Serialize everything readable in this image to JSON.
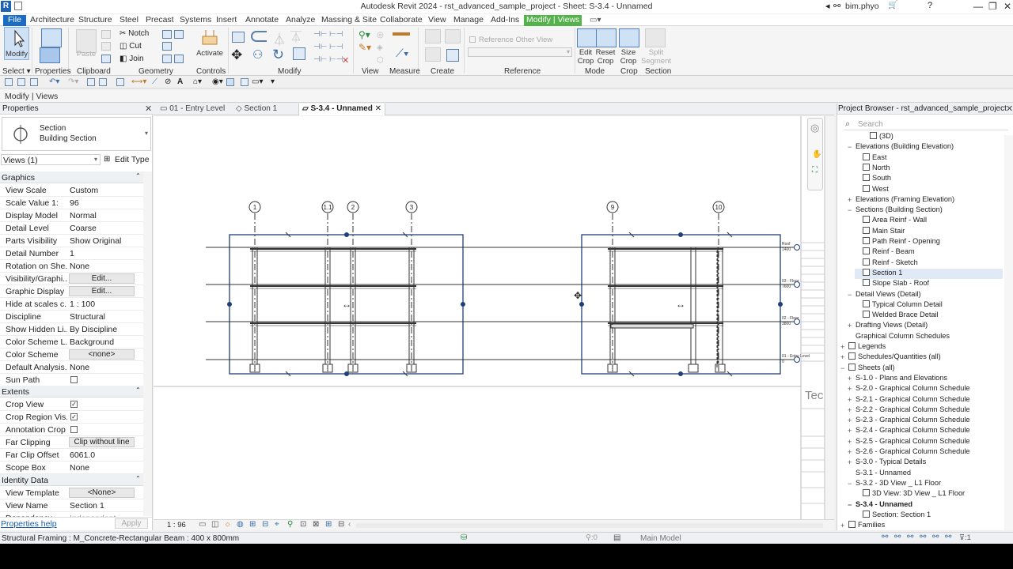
{
  "titlebar": {
    "title": "Autodesk Revit 2024 - rst_advanced_sample_project - Sheet: S-3.4 - Unnamed",
    "user": "bim.phyo",
    "app_logo": "R"
  },
  "menu": {
    "tabs": [
      "File",
      "Architecture",
      "Structure",
      "Steel",
      "Precast",
      "Systems",
      "Insert",
      "Annotate",
      "Analyze",
      "Massing & Site",
      "Collaborate",
      "View",
      "Manage",
      "Add-Ins",
      "Modify | Views"
    ]
  },
  "ribbon": {
    "modify_label": "Modify",
    "notch_label": "Notch",
    "cut_label": "Cut",
    "join_label": "Join",
    "paste_label": "Paste",
    "activate_label": "Activate",
    "reference_other_view": "Reference Other View",
    "edit_crop": "Edit Crop",
    "reset_crop": "Reset Crop",
    "size_crop": "Size Crop",
    "split_segment": "Split Segment",
    "panels": [
      "Select",
      "Properties",
      "Clipboard",
      "Geometry",
      "Controls",
      "Modify",
      "View",
      "Measure",
      "Create",
      "Reference",
      "Mode",
      "Crop",
      "Section"
    ]
  },
  "options_bar": {
    "text": "Modify | Views"
  },
  "properties": {
    "header": "Properties",
    "type_line1": "Section",
    "type_line2": "Building Section",
    "views_selector": "Views (1)",
    "edit_type": "Edit Type",
    "groups": {
      "graphics": "Graphics",
      "extents": "Extents",
      "identity": "Identity Data"
    },
    "graphics_rows": [
      {
        "k": "View Scale",
        "v": "Custom"
      },
      {
        "k": "Scale Value    1:",
        "v": "96"
      },
      {
        "k": "Display Model",
        "v": "Normal"
      },
      {
        "k": "Detail Level",
        "v": "Coarse"
      },
      {
        "k": "Parts Visibility",
        "v": "Show Original"
      },
      {
        "k": "Detail Number",
        "v": "1"
      },
      {
        "k": "Rotation on She...",
        "v": "None"
      },
      {
        "k": "Visibility/Graphi...",
        "v": "Edit..."
      },
      {
        "k": "Graphic Display ...",
        "v": "Edit..."
      },
      {
        "k": "Hide at scales c...",
        "v": "1 : 100"
      },
      {
        "k": "Discipline",
        "v": "Structural"
      },
      {
        "k": "Show Hidden Li...",
        "v": "By Discipline"
      },
      {
        "k": "Color Scheme L...",
        "v": "Background"
      },
      {
        "k": "Color Scheme",
        "v": "<none>"
      },
      {
        "k": "Default Analysis...",
        "v": "None"
      },
      {
        "k": "Sun Path",
        "v": ""
      }
    ],
    "extents_rows": [
      {
        "k": "Crop View",
        "v": "✓"
      },
      {
        "k": "Crop Region Vis...",
        "v": "✓"
      },
      {
        "k": "Annotation Crop",
        "v": ""
      },
      {
        "k": "Far Clipping",
        "v": "Clip without line"
      },
      {
        "k": "Far Clip Offset",
        "v": "6061.0"
      },
      {
        "k": "Scope Box",
        "v": "None"
      }
    ],
    "identity_rows": [
      {
        "k": "View Template",
        "v": "<None>"
      },
      {
        "k": "View Name",
        "v": "Section 1"
      },
      {
        "k": "Dependency",
        "v": "Independent"
      }
    ],
    "help_link": "Properties help",
    "apply": "Apply"
  },
  "view_tabs": [
    "01 - Entry Level",
    "Section 1",
    "S-3.4 - Unnamed"
  ],
  "canvas": {
    "grid_labels_left": [
      "1",
      "1.1",
      "2",
      "3"
    ],
    "grid_labels_right": [
      "9",
      "10"
    ],
    "levels": [
      "Roof",
      "03 - Floor",
      "02 - Floor",
      "01 - Entry Level"
    ],
    "level_values": [
      "1400",
      "7600",
      "3800",
      "0"
    ],
    "titleblock_text": "Tec",
    "view_scale": "1 : 96"
  },
  "browser": {
    "header": "Project Browser - rst_advanced_sample_project",
    "search_placeholder": "Search",
    "items": [
      {
        "label": "(3D)",
        "level": 3,
        "icon": true,
        "exp": ""
      },
      {
        "label": "Elevations (Building Elevation)",
        "level": 1,
        "icon": false,
        "exp": "−"
      },
      {
        "label": "East",
        "level": 2,
        "icon": true,
        "exp": ""
      },
      {
        "label": "North",
        "level": 2,
        "icon": true,
        "exp": ""
      },
      {
        "label": "South",
        "level": 2,
        "icon": true,
        "exp": ""
      },
      {
        "label": "West",
        "level": 2,
        "icon": true,
        "exp": ""
      },
      {
        "label": "Elevations (Framing Elevation)",
        "level": 1,
        "icon": false,
        "exp": "+"
      },
      {
        "label": "Sections (Building Section)",
        "level": 1,
        "icon": false,
        "exp": "−"
      },
      {
        "label": "Area Reinf - Wall",
        "level": 2,
        "icon": true,
        "exp": ""
      },
      {
        "label": "Main Stair",
        "level": 2,
        "icon": true,
        "exp": ""
      },
      {
        "label": "Path Reinf - Opening",
        "level": 2,
        "icon": true,
        "exp": ""
      },
      {
        "label": "Reinf - Beam",
        "level": 2,
        "icon": true,
        "exp": ""
      },
      {
        "label": "Reinf - Sketch",
        "level": 2,
        "icon": true,
        "exp": ""
      },
      {
        "label": "Section 1",
        "level": 2,
        "icon": true,
        "exp": "",
        "sel": true
      },
      {
        "label": "Slope Slab - Roof",
        "level": 2,
        "icon": true,
        "exp": ""
      },
      {
        "label": "Detail Views (Detail)",
        "level": 1,
        "icon": false,
        "exp": "−"
      },
      {
        "label": "Typical Column Detail",
        "level": 2,
        "icon": true,
        "exp": ""
      },
      {
        "label": "Welded Brace Detail",
        "level": 2,
        "icon": true,
        "exp": ""
      },
      {
        "label": "Drafting Views (Detail)",
        "level": 1,
        "icon": false,
        "exp": "+"
      },
      {
        "label": "Graphical Column Schedules",
        "level": 1,
        "icon": false,
        "exp": ""
      },
      {
        "label": "Legends",
        "level": 0,
        "icon": true,
        "exp": "+"
      },
      {
        "label": "Schedules/Quantities (all)",
        "level": 0,
        "icon": true,
        "exp": "+"
      },
      {
        "label": "Sheets (all)",
        "level": 0,
        "icon": true,
        "exp": "−"
      },
      {
        "label": "S-1.0 - Plans and Elevations",
        "level": 1,
        "icon": false,
        "exp": "+"
      },
      {
        "label": "S-2.0 - Graphical Column Schedule",
        "level": 1,
        "icon": false,
        "exp": "+"
      },
      {
        "label": "S-2.1 - Graphical Column Schedule",
        "level": 1,
        "icon": false,
        "exp": "+"
      },
      {
        "label": "S-2.2 - Graphical Column Schedule",
        "level": 1,
        "icon": false,
        "exp": "+"
      },
      {
        "label": "S-2.3 - Graphical Column Schedule",
        "level": 1,
        "icon": false,
        "exp": "+"
      },
      {
        "label": "S-2.4 - Graphical Column Schedule",
        "level": 1,
        "icon": false,
        "exp": "+"
      },
      {
        "label": "S-2.5 - Graphical Column Schedule",
        "level": 1,
        "icon": false,
        "exp": "+"
      },
      {
        "label": "S-2.6 - Graphical Column Schedule",
        "level": 1,
        "icon": false,
        "exp": "+"
      },
      {
        "label": "S-3.0 - Typical Details",
        "level": 1,
        "icon": false,
        "exp": "+"
      },
      {
        "label": "S-3.1 - Unnamed",
        "level": 1,
        "icon": false,
        "exp": ""
      },
      {
        "label": "S-3.2 - 3D View _ L1 Floor",
        "level": 1,
        "icon": false,
        "exp": "−"
      },
      {
        "label": "3D View: 3D View _ L1 Floor",
        "level": 2,
        "icon": true,
        "exp": ""
      },
      {
        "label": "S-3.4 - Unnamed",
        "level": 1,
        "icon": false,
        "exp": "−",
        "bold": true
      },
      {
        "label": "Section: Section 1",
        "level": 2,
        "icon": true,
        "exp": ""
      },
      {
        "label": "Families",
        "level": 0,
        "icon": true,
        "exp": "+"
      }
    ]
  },
  "statusbar": {
    "text": "Structural Framing : M_Concrete-Rectangular Beam : 400 x 800mm",
    "selection_count": ":0",
    "model": "Main Model",
    "filter_count": ":1"
  },
  "colors": {
    "file_tab": "#1b6cc4",
    "active_tab": "#54b24a",
    "crop_region": "#1f3f7a",
    "selected_item": "#dfeaf6"
  }
}
